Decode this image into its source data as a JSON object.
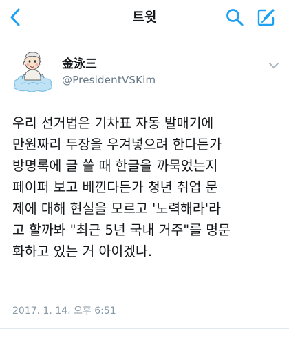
{
  "header": {
    "title": "트윗",
    "back_icon": "chevron-left-icon",
    "search_icon": "search-icon",
    "compose_icon": "compose-tweet-icon"
  },
  "tweet": {
    "display_name": "金泳三",
    "handle": "@PresidentVSKim",
    "avatar_icon": "cartoon-avatar",
    "menu_icon": "chevron-down-icon",
    "text_lines": [
      "우리 선거법은 기차표 자동 발매기에",
      "만원짜리 두장을 우겨넣으려 한다든가",
      "방명록에 글 쓸 때 한글을 까묵었는지",
      "페이퍼 보고 베낀다든가 청년 취업 문",
      "제에 대해 현실을 모르고 '노력해라'라",
      "고 할까봐 \"최근 5년 국내 거주\"를 명문",
      "화하고 있는 거 아이겠나."
    ],
    "timestamp": "2017. 1. 14. 오후 6:51"
  },
  "colors": {
    "accent": "#1da1f2",
    "text": "#14171a",
    "secondary": "#657786",
    "divider": "#e1e8ed"
  }
}
